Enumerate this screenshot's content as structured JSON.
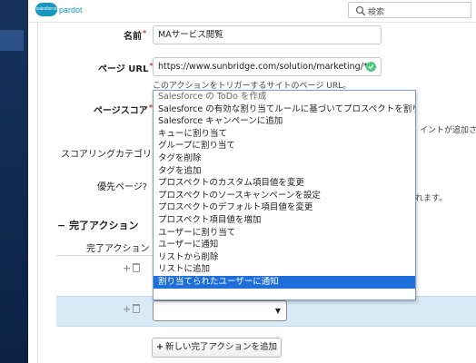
{
  "header": {
    "logo_text": "salesforce",
    "product": "pardot",
    "search_placeholder": "検索"
  },
  "form": {
    "name_label": "名前",
    "name_value": "MAサービス閲覧",
    "page_url_label": "ページ URL",
    "page_url_value": "https://www.sunbridge.com/solution/marketing/*",
    "page_url_help": "このアクションをトリガーするサイトのページ URL。",
    "page_score_label": "ページスコア",
    "scoring_category_label": "スコアリングカテゴリ",
    "priority_page_label": "優先ページ?",
    "right_text_1": "イントが追加されま",
    "right_text_2": "れます。"
  },
  "completion": {
    "section_title": "完了アクション",
    "row_label": "完了アクション",
    "add_button_label": "新しい完了アクションを追加"
  },
  "dropdown": {
    "options": [
      "Salesforce の ToDo を作成",
      "Salesforce の有効な割り当てルールに基づいてプロスペクトを割り当て",
      "Salesforce キャンペーンに追加",
      "キューに割り当て",
      "グループに割り当て",
      "タグを削除",
      "タグを追加",
      "プロスペクトのカスタム項目値を変更",
      "プロスペクトのソースキャンペーンを設定",
      "プロスペクトのデフォルト項目値を変更",
      "プロスペクト項目値を増加",
      "ユーザーに割り当て",
      "ユーザーに通知",
      "リストから削除",
      "リストに追加",
      "割り当てられたユーザーに通知"
    ],
    "selected": "割り当てられたユーザーに通知"
  },
  "colors": {
    "sidebar": "#16325c",
    "accent": "#1798c1",
    "selection": "#1e6fd9",
    "row_highlight": "#d9eaf7",
    "required": "#c23934",
    "valid": "#4bca81"
  }
}
